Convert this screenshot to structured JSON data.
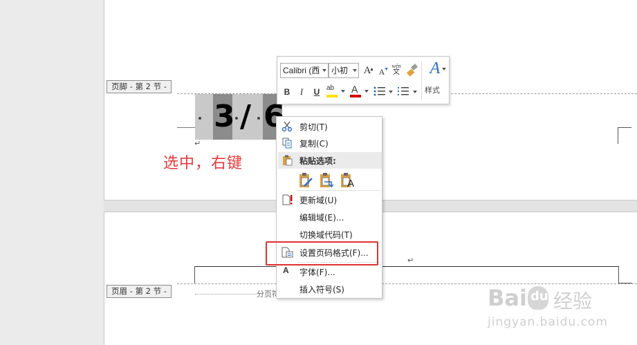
{
  "document": {
    "footer_tag": "页脚 - 第 2 节 -",
    "header_tag": "页眉 - 第 2 节 -",
    "section_break": "分页符",
    "field": {
      "current": "3",
      "separator": "/",
      "total": "6"
    },
    "return_mark": "↵"
  },
  "annotation": "选中，右键",
  "mini_toolbar": {
    "font_name": "Calibri (西",
    "font_size": "小初",
    "grow_font": "A",
    "shrink_font": "A",
    "phonetic_top": "wén",
    "phonetic_bottom": "文",
    "bold": "B",
    "italic": "I",
    "underline": "U",
    "highlight_letters": "ab",
    "font_color_letter": "A",
    "styles_icon": "A",
    "styles_label": "样式"
  },
  "context_menu": {
    "items": [
      {
        "label": "剪切(T)"
      },
      {
        "label": "复制(C)"
      },
      {
        "label": "粘贴选项:"
      },
      {
        "label": "更新域(U)"
      },
      {
        "label": "编辑域(E)..."
      },
      {
        "label": "切换域代码(T)"
      },
      {
        "label": "设置页码格式(F)..."
      },
      {
        "label": "字体(F)..."
      },
      {
        "label": "插入符号(S)"
      }
    ],
    "paste_letter": "A"
  },
  "colors": {
    "annotation": "#e53a3a",
    "highlight_box": "#e03030",
    "highlight_yellow": "#ffe100",
    "font_color_red": "#d40000",
    "style_blue": "#2e6fc7"
  },
  "watermark": {
    "brand": "Bai",
    "paw": "du",
    "cn": "经验",
    "url": "jingyan.baidu.com"
  }
}
